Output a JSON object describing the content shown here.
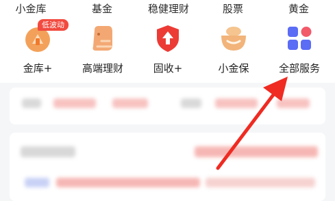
{
  "top_row": {
    "items": [
      {
        "label": "小金库"
      },
      {
        "label": "基金"
      },
      {
        "label": "稳健理财"
      },
      {
        "label": "股票"
      },
      {
        "label": "黄金"
      }
    ]
  },
  "shortcuts": [
    {
      "label": "金库+",
      "icon": "vault-plus-icon",
      "badge": "低波动",
      "color": "#f3a15a"
    },
    {
      "label": "高端理财",
      "icon": "premium-wealth-icon",
      "color": "#f3a874"
    },
    {
      "label": "固收+",
      "icon": "fixed-income-shield-icon",
      "color": "#ec3b35"
    },
    {
      "label": "小金保",
      "icon": "gold-bowl-icon",
      "color": "#f2b47a"
    },
    {
      "label": "全部服务",
      "icon": "all-services-grid-icon",
      "colors": [
        "#5b6cf5",
        "#f25a6a"
      ]
    }
  ],
  "annotation": {
    "arrow_color": "#ef2b22"
  }
}
